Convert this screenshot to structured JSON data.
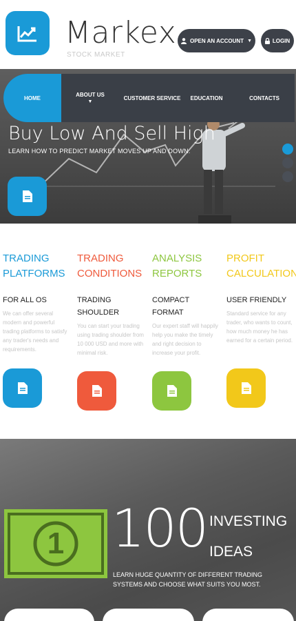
{
  "header": {
    "brand": "Markex",
    "tagline": "STOCK MARKET",
    "account_button": "OPEN AN ACCOUNT",
    "login_button": "LOGIN"
  },
  "nav": {
    "items": [
      {
        "label": "HOME",
        "active": true
      },
      {
        "label": "ABOUT US",
        "has_dropdown": true
      },
      {
        "label": "CUSTOMER SERVICE"
      },
      {
        "label": "EDUCATION"
      },
      {
        "label": "CONTACTS"
      }
    ]
  },
  "hero": {
    "title": "Buy Low And Sell High",
    "subtitle": "LEARN HOW TO PREDICT MARKET MOVES UP AND DOWN.",
    "slides": 3,
    "active_slide": 1
  },
  "features": [
    {
      "title_line1": "TRADING",
      "title_line2": "PLATFORMS",
      "subtitle_line1": "FOR ALL OS",
      "subtitle_line2": "",
      "text": "We can offer several modern and powerful trading platforms to satisfy any trader's needs and requirements.",
      "color": "#1a9ad7"
    },
    {
      "title_line1": "TRADING",
      "title_line2": "CONDITIONS",
      "subtitle_line1": "TRADING",
      "subtitle_line2": "SHOULDER",
      "text": "You can start your trading using trading shoulder from 10 000 USD and more with minimal risk.",
      "color": "#ef5a3c"
    },
    {
      "title_line1": "ANALYSIS",
      "title_line2": "REPORTS",
      "subtitle_line1": "COMPACT",
      "subtitle_line2": "FORMAT",
      "text": "Our expert staff will happily help you make the timely and right decision to increase your profit.",
      "color": "#8dc63f"
    },
    {
      "title_line1": "PROFIT",
      "title_line2": "CALCULATION",
      "subtitle_line1": "USER FRIENDLY",
      "subtitle_line2": "",
      "text": "Standard service for any trader, who wants to count, how much money he has earned for a certain period.",
      "color": "#f2c81a"
    }
  ],
  "promo": {
    "number": "100",
    "word1": "INVESTING",
    "word2": "IDEAS",
    "text": "LEARN HUGE QUANTITY OF DIFFERENT TRADING SYSTEMS AND CHOOSE WHAT SUITS YOU MOST.",
    "bill_value": "1",
    "bill_color": "#8dc63f"
  },
  "colors": {
    "accent": "#1a9ad7",
    "dark": "#3a3f47"
  },
  "icons": {
    "logo": "chart-trend-icon",
    "user": "user-icon",
    "lock": "lock-icon",
    "document": "document-icon"
  }
}
